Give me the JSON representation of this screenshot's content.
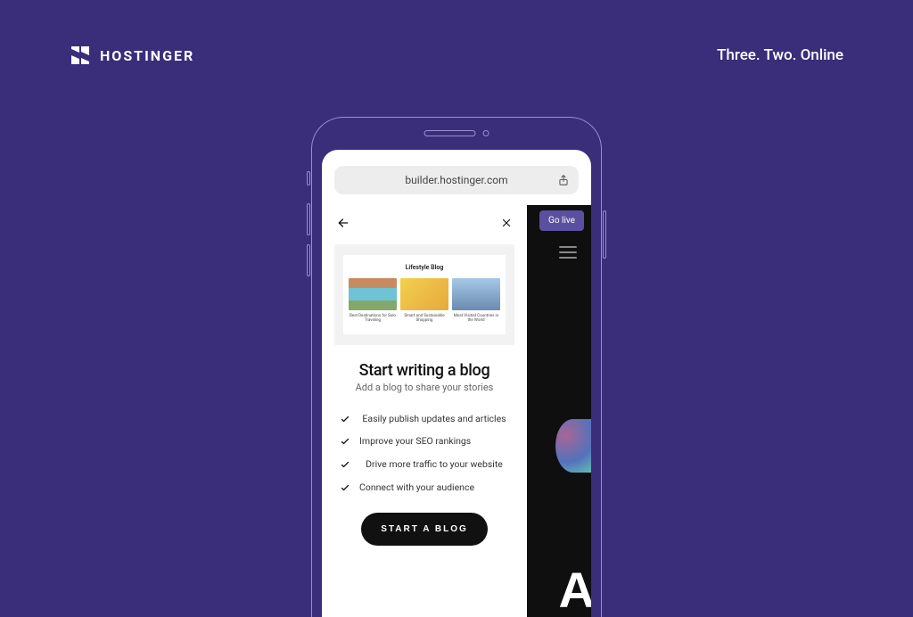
{
  "brand": {
    "name": "HOSTINGER"
  },
  "tagline": "Three. Two. Online",
  "urlbar": {
    "text": "builder.hostinger.com"
  },
  "background_app": {
    "go_live_label": "Go live",
    "peek_letter": "A"
  },
  "panel": {
    "preview": {
      "title": "Lifestyle Blog",
      "cards": [
        {
          "caption": "Best Destinations for Solo Traveling",
          "link": ""
        },
        {
          "caption": "Smart and Sustainable Shopping",
          "link": ""
        },
        {
          "caption": "Most Visited Countries in the World",
          "link": ""
        }
      ]
    },
    "heading": "Start writing a blog",
    "subheading": "Add a blog to share your stories",
    "benefits": [
      "Easily publish updates and articles",
      "Improve your SEO rankings",
      "Drive more traffic to your website",
      "Connect with your audience"
    ],
    "cta_label": "START A BLOG"
  }
}
